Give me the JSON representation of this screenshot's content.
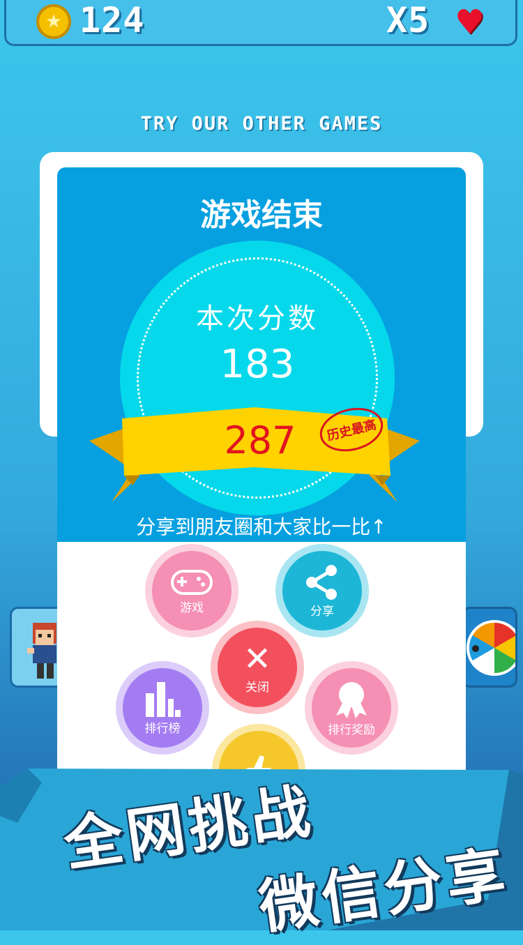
{
  "hud": {
    "coins": "124",
    "lives": "X5",
    "coin_icon": "star-coin-icon",
    "heart_icon": "heart-icon"
  },
  "try_other_games": "TRY OUR OTHER GAMES",
  "dialog": {
    "title": "游戏结束",
    "score_label": "本次分数",
    "score": "183",
    "best_score": "287",
    "best_stamp": "历史最高",
    "share_hint": "分享到朋友圈和大家比一比↑"
  },
  "buttons": {
    "game": "游戏",
    "share": "分享",
    "close": "关闭",
    "rank": "排行榜",
    "award": "排行奖励"
  },
  "promo": {
    "line1": "全网挑战",
    "line2": "微信分享"
  },
  "colors": {
    "dialog_blue": "#06a0e0",
    "circle_cyan": "#05d8ea",
    "ribbon_yellow": "#ffd200",
    "best_red": "#e2131e"
  }
}
